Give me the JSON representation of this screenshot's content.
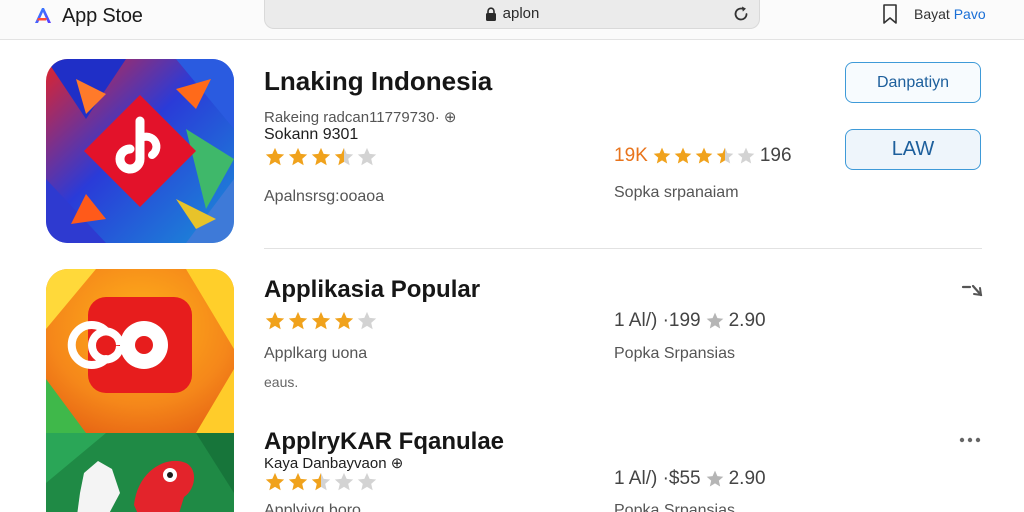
{
  "header": {
    "app_name": "App Stoe",
    "url": "aplon",
    "right_label_a": "Bayat",
    "right_label_b": "Pavo"
  },
  "apps": [
    {
      "title": "Lnaking Indonesia",
      "subtitle": "Rakeing radcan11779730· ⊕",
      "developer": "Sokann 9301",
      "rating": 3.5,
      "meta": "Apalnsrsg:ooaoa",
      "stat_highlight": "19K",
      "stat_value": "196",
      "stat_sub": "Sopka srpanaiam",
      "primary_button": "Danpatiyn",
      "secondary_button": "LAW"
    },
    {
      "title": "Applikasia Popular",
      "rating": 4,
      "meta": "Applkarg uona",
      "meta2": "eaus.",
      "stat_prefix": "1 Al/) ·199",
      "stat_value": "2.90",
      "stat_sub": "Popka Srpansias"
    },
    {
      "title": "ApplryKAR Fqanulae",
      "subtitle": "Kaya Danbayvaon ⊕",
      "rating": 2.5,
      "meta": "Applyivg boro",
      "stat_prefix": "1 Al/) ·$55",
      "stat_value": "2.90",
      "stat_sub": "Popka Srpansias"
    }
  ],
  "colors": {
    "accent": "#1a6fd6",
    "star_filled": "#f0a21c",
    "star_empty": "#d3d3d3",
    "button_border": "#3e9ad8",
    "highlight": "#e8741c"
  },
  "icons": [
    "app-store-logo-icon",
    "lock-icon",
    "reload-icon",
    "bookmark-icon",
    "star-icon",
    "share-icon",
    "more-icon"
  ]
}
